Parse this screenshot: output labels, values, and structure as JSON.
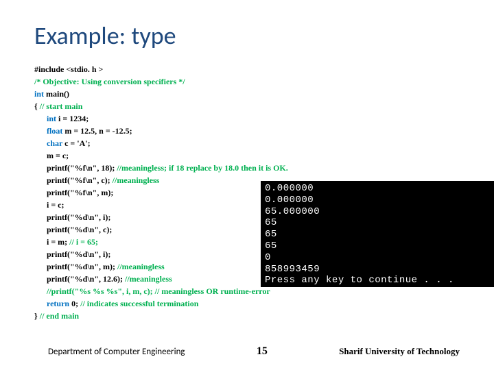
{
  "title": "Example: type",
  "code": {
    "l1": "#include <stdio. h >",
    "l2a": "/*  Objective: Using conversion specifiers */",
    "l3a": "int",
    "l3b": " main()",
    "l4a": "{ ",
    "l4b": "// start main",
    "l5a": "int",
    "l5b": " i = 1234;",
    "l6a": "float",
    "l6b": " m = 12.5, n = -12.5;",
    "l7a": "char",
    "l7b": " c = 'A';",
    "l8": "m = c;",
    "l9a": "printf(\"%f\\n\", 18); ",
    "l9b": "//meaningless; if 18 replace by 18.0 then it is OK.",
    "l10a": "printf(\"%f\\n\", c); ",
    "l10b": "//meaningless",
    "l11": "printf(\"%f\\n\", m);",
    "l12": "i = c;",
    "l13": "printf(\"%d\\n\", i);",
    "l14": "printf(\"%d\\n\", c);",
    "l15a": "i = m; ",
    "l15b": "// i = 65;",
    "l16": "printf(\"%d\\n\", i);",
    "l17a": "printf(\"%d\\n\", m); ",
    "l17b": "//meaningless",
    "l18a": "printf(\"%d\\n\", 12.6); ",
    "l18b": "//meaningless",
    "l19b": "//printf(\"%s %s %s\", i, m, c); // meaningless OR runtime-error",
    "l20a": "return",
    "l20b": " 0; ",
    "l20c": "// indicates successful termination",
    "l21a": "} ",
    "l21b": "// end main"
  },
  "console": {
    "o1": "0.000000",
    "o2": "0.000000",
    "o3": "65.000000",
    "o4": "65",
    "o5": "65",
    "o6": "65",
    "o7": "0",
    "o8": "858993459",
    "o9": "Press any key to continue . . ."
  },
  "footer": {
    "left": "Department of Computer Engineering",
    "page": "15",
    "right": "Sharif University of Technology"
  }
}
